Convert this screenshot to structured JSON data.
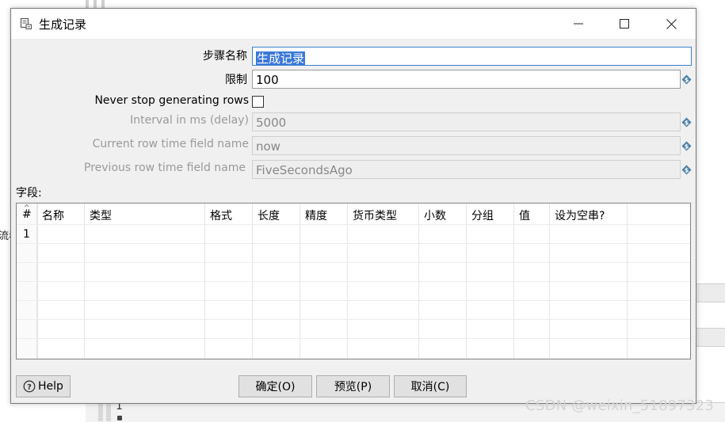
{
  "dialog": {
    "title": "生成记录"
  },
  "form": {
    "step_name_label": "步骤名称",
    "step_name_value": "生成记录",
    "limit_label": "限制",
    "limit_value": "100",
    "never_stop_label": "Never stop generating rows",
    "never_stop_checked": false,
    "interval_label": "Interval in ms (delay)",
    "interval_value": "5000",
    "current_row_label": "Current row time field name",
    "current_row_value": "now",
    "previous_row_label": "Previous row time field name",
    "previous_row_value": "FiveSecondsAgo"
  },
  "fields": {
    "section_label": "字段:",
    "columns": [
      "#",
      "名称",
      "类型",
      "格式",
      "长度",
      "精度",
      "货币类型",
      "小数",
      "分组",
      "值",
      "设为空串?"
    ],
    "rows": [
      [
        "1",
        "",
        "",
        "",
        "",
        "",
        "",
        "",
        "",
        "",
        ""
      ]
    ]
  },
  "buttons": {
    "help": "Help",
    "ok": "确定(O)",
    "preview": "预览(P)",
    "cancel": "取消(C)"
  },
  "background": {
    "left_text": "流看",
    "bottom_number": "1"
  },
  "watermark": "CSDN @weixin_51897323",
  "colors": {
    "dialog_bg": "#f0f0f0",
    "selection": "#3b78d8",
    "disabled_text": "#9a9a9a"
  },
  "icons": {
    "title": "step-icon",
    "variable": "variable-dollar-icon",
    "help": "help-circle-icon"
  }
}
